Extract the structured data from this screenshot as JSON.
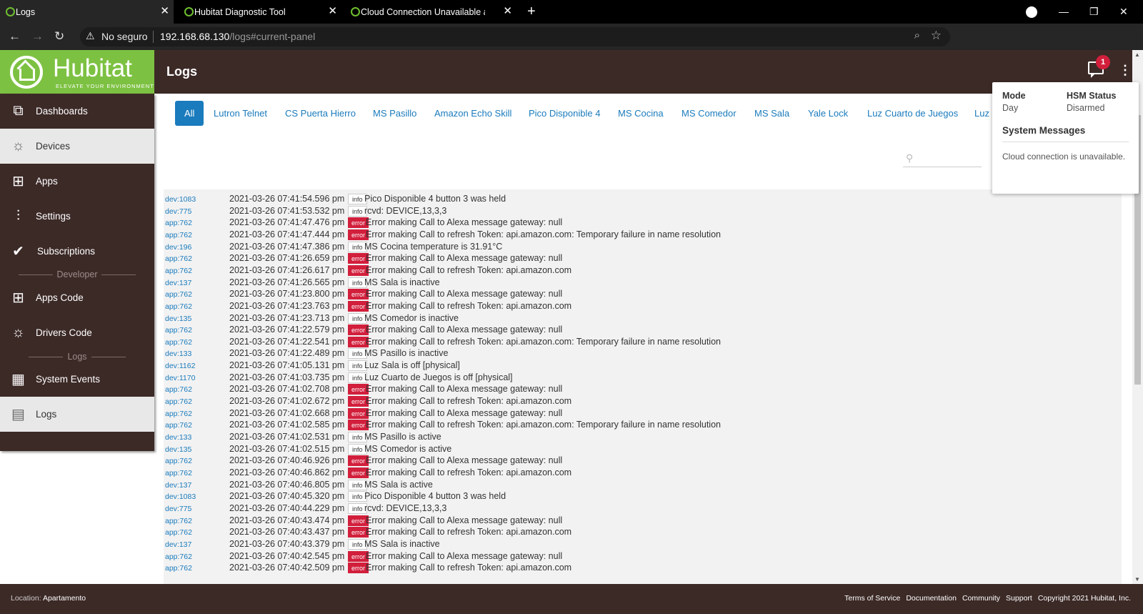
{
  "browser": {
    "tabs": [
      {
        "title": "Logs"
      },
      {
        "title": "Hubitat Diagnostic Tool"
      },
      {
        "title": "Cloud Connection Unavailable af"
      }
    ],
    "new_tab": "+",
    "insecure_label": "No seguro",
    "url_host": "192.168.68.130",
    "url_path": "/logs#current-panel"
  },
  "header": {
    "brand": "Hubitat",
    "tagline": "ELEVATE YOUR ENVIRONMENT",
    "page_title": "Logs",
    "notification_count": "1"
  },
  "sidebar": {
    "items": [
      {
        "label": "Dashboards",
        "icon": "dashboards-icon"
      },
      {
        "label": "Devices",
        "icon": "lightbulb-icon"
      },
      {
        "label": "Apps",
        "icon": "apps-grid-icon"
      },
      {
        "label": "Settings",
        "icon": "sliders-icon"
      },
      {
        "label": "Subscriptions",
        "icon": "check-circle-icon"
      }
    ],
    "developer_header": "Developer",
    "developer_items": [
      {
        "label": "Apps Code",
        "icon": "apps-code-icon"
      },
      {
        "label": "Drivers Code",
        "icon": "drivers-code-icon"
      }
    ],
    "logs_header": "Logs",
    "log_items": [
      {
        "label": "System Events",
        "icon": "calendar-icon"
      },
      {
        "label": "Logs",
        "icon": "document-icon"
      }
    ]
  },
  "filters": [
    "All",
    "Lutron Telnet",
    "CS Puerta Hierro",
    "MS Pasillo",
    "Amazon Echo Skill",
    "Pico Disponible 4",
    "MS Cocina",
    "MS Comedor",
    "MS Sala",
    "Yale Lock",
    "Luz Cuarto de Juegos",
    "Luz"
  ],
  "popup": {
    "mode_label": "Mode",
    "mode_value": "Day",
    "hsm_label": "HSM Status",
    "hsm_value": "Disarmed",
    "messages_title": "System Messages",
    "message": "Cloud connection is unavailable."
  },
  "logs": [
    {
      "src": "dev:1083",
      "ts": "2021-03-26 07:41:54.596 pm",
      "level": "info",
      "msg": "Pico Disponible 4 button 3 was held"
    },
    {
      "src": "dev:775",
      "ts": "2021-03-26 07:41:53.532 pm",
      "level": "info",
      "msg": "rcvd: DEVICE,13,3,3"
    },
    {
      "src": "app:762",
      "ts": "2021-03-26 07:41:47.476 pm",
      "level": "error",
      "msg": "Error making Call to Alexa message gateway: null"
    },
    {
      "src": "app:762",
      "ts": "2021-03-26 07:41:47.444 pm",
      "level": "error",
      "msg": "Error making Call to refresh Token: api.amazon.com: Temporary failure in name resolution"
    },
    {
      "src": "dev:196",
      "ts": "2021-03-26 07:41:47.386 pm",
      "level": "info",
      "msg": "MS Cocina temperature is 31.91°C"
    },
    {
      "src": "app:762",
      "ts": "2021-03-26 07:41:26.659 pm",
      "level": "error",
      "msg": "Error making Call to Alexa message gateway: null"
    },
    {
      "src": "app:762",
      "ts": "2021-03-26 07:41:26.617 pm",
      "level": "error",
      "msg": "Error making Call to refresh Token: api.amazon.com"
    },
    {
      "src": "dev:137",
      "ts": "2021-03-26 07:41:26.565 pm",
      "level": "info",
      "msg": "MS Sala is inactive"
    },
    {
      "src": "app:762",
      "ts": "2021-03-26 07:41:23.800 pm",
      "level": "error",
      "msg": "Error making Call to Alexa message gateway: null"
    },
    {
      "src": "app:762",
      "ts": "2021-03-26 07:41:23.763 pm",
      "level": "error",
      "msg": "Error making Call to refresh Token: api.amazon.com"
    },
    {
      "src": "dev:135",
      "ts": "2021-03-26 07:41:23.713 pm",
      "level": "info",
      "msg": "MS Comedor is inactive"
    },
    {
      "src": "app:762",
      "ts": "2021-03-26 07:41:22.579 pm",
      "level": "error",
      "msg": "Error making Call to Alexa message gateway: null"
    },
    {
      "src": "app:762",
      "ts": "2021-03-26 07:41:22.541 pm",
      "level": "error",
      "msg": "Error making Call to refresh Token: api.amazon.com: Temporary failure in name resolution"
    },
    {
      "src": "dev:133",
      "ts": "2021-03-26 07:41:22.489 pm",
      "level": "info",
      "msg": "MS Pasillo is inactive"
    },
    {
      "src": "dev:1162",
      "ts": "2021-03-26 07:41:05.131 pm",
      "level": "info",
      "msg": "Luz Sala is off [physical]"
    },
    {
      "src": "dev:1170",
      "ts": "2021-03-26 07:41:03.735 pm",
      "level": "info",
      "msg": "Luz Cuarto de Juegos is off [physical]"
    },
    {
      "src": "app:762",
      "ts": "2021-03-26 07:41:02.708 pm",
      "level": "error",
      "msg": "Error making Call to Alexa message gateway: null"
    },
    {
      "src": "app:762",
      "ts": "2021-03-26 07:41:02.672 pm",
      "level": "error",
      "msg": "Error making Call to refresh Token: api.amazon.com"
    },
    {
      "src": "app:762",
      "ts": "2021-03-26 07:41:02.668 pm",
      "level": "error",
      "msg": "Error making Call to Alexa message gateway: null"
    },
    {
      "src": "app:762",
      "ts": "2021-03-26 07:41:02.585 pm",
      "level": "error",
      "msg": "Error making Call to refresh Token: api.amazon.com: Temporary failure in name resolution"
    },
    {
      "src": "dev:133",
      "ts": "2021-03-26 07:41:02.531 pm",
      "level": "info",
      "msg": "MS Pasillo is active"
    },
    {
      "src": "dev:135",
      "ts": "2021-03-26 07:41:02.515 pm",
      "level": "info",
      "msg": "MS Comedor is active"
    },
    {
      "src": "app:762",
      "ts": "2021-03-26 07:40:46.926 pm",
      "level": "error",
      "msg": "Error making Call to Alexa message gateway: null"
    },
    {
      "src": "app:762",
      "ts": "2021-03-26 07:40:46.862 pm",
      "level": "error",
      "msg": "Error making Call to refresh Token: api.amazon.com"
    },
    {
      "src": "dev:137",
      "ts": "2021-03-26 07:40:46.805 pm",
      "level": "info",
      "msg": "MS Sala is active"
    },
    {
      "src": "dev:1083",
      "ts": "2021-03-26 07:40:45.320 pm",
      "level": "info",
      "msg": "Pico Disponible 4 button 3 was held"
    },
    {
      "src": "dev:775",
      "ts": "2021-03-26 07:40:44.229 pm",
      "level": "info",
      "msg": "rcvd: DEVICE,13,3,3"
    },
    {
      "src": "app:762",
      "ts": "2021-03-26 07:40:43.474 pm",
      "level": "error",
      "msg": "Error making Call to Alexa message gateway: null"
    },
    {
      "src": "app:762",
      "ts": "2021-03-26 07:40:43.437 pm",
      "level": "error",
      "msg": "Error making Call to refresh Token: api.amazon.com"
    },
    {
      "src": "dev:137",
      "ts": "2021-03-26 07:40:43.379 pm",
      "level": "info",
      "msg": "MS Sala is inactive"
    },
    {
      "src": "app:762",
      "ts": "2021-03-26 07:40:42.545 pm",
      "level": "error",
      "msg": "Error making Call to Alexa message gateway: null"
    },
    {
      "src": "app:762",
      "ts": "2021-03-26 07:40:42.509 pm",
      "level": "error",
      "msg": "Error making Call to refresh Token: api.amazon.com"
    }
  ],
  "footer": {
    "location_label": "Location:",
    "location_value": "Apartamento",
    "links": [
      "Terms of Service",
      "Documentation",
      "Community",
      "Support"
    ],
    "copyright": "Copyright 2021 Hubitat, Inc."
  },
  "colors": {
    "brand_green": "#7dc142",
    "header_brown": "#3c2a27",
    "link_blue": "#1a7bbd",
    "error_red": "#d21f3c"
  }
}
